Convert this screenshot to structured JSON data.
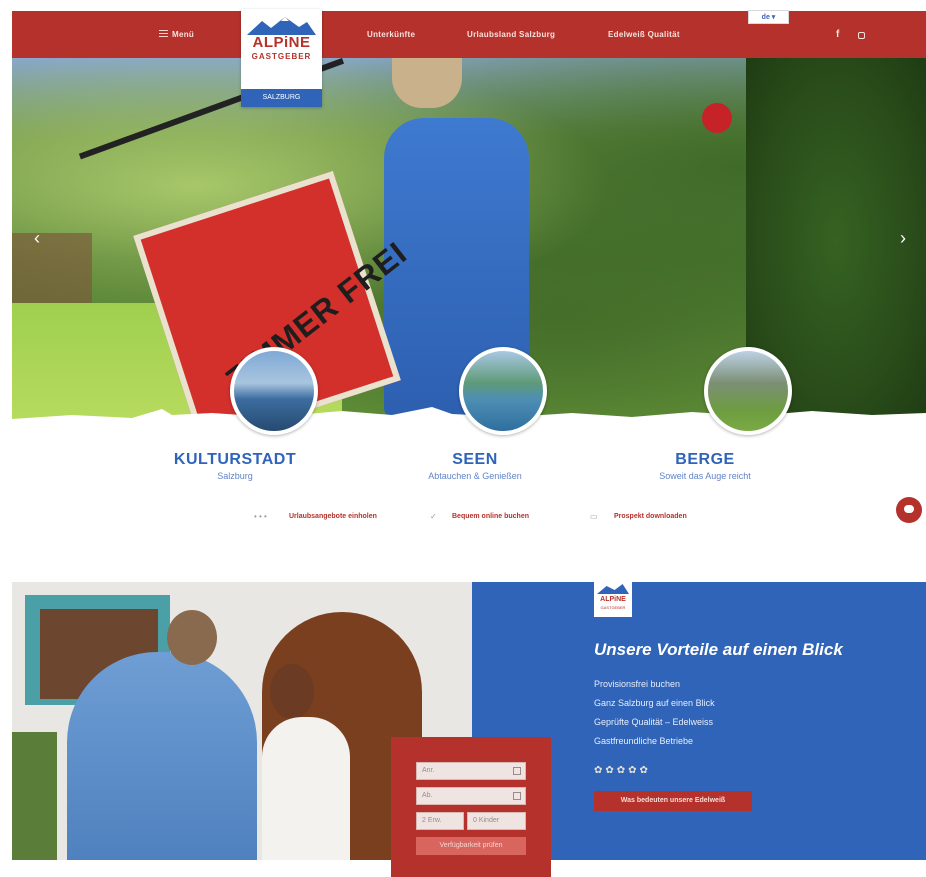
{
  "header": {
    "menu_label": "Menü",
    "nav": [
      "Unterkünfte",
      "Urlaubsland Salzburg",
      "Edelweiß Qualität"
    ],
    "language": "de ▾",
    "logo": {
      "line1": "ALPiNE",
      "line2": "GASTGEBER",
      "line3": "SALZBURG"
    },
    "social": {
      "facebook_icon": "f"
    }
  },
  "hero": {
    "prev_icon": "‹",
    "next_icon": "›",
    "flag_text": "ZIMMER FREI"
  },
  "categories": [
    {
      "title": "KULTURSTADT",
      "subtitle": "Salzburg"
    },
    {
      "title": "SEEN",
      "subtitle": "Abtauchen & Genießen"
    },
    {
      "title": "BERGE",
      "subtitle": "Soweit das Auge reicht"
    }
  ],
  "actions": [
    {
      "icon": "• • •",
      "label": "Urlaubsangebote einholen"
    },
    {
      "icon": "✓",
      "label": "Bequem online buchen"
    },
    {
      "icon": "▭",
      "label": "Prospekt downloaden"
    }
  ],
  "advantages": {
    "logo_line1": "ALPiNE",
    "logo_line2": "GASTGEBER",
    "heading": "Unsere Vorteile auf einen Blick",
    "items": [
      "Provisionsfrei buchen",
      "Ganz Salzburg auf einen Blick",
      "Geprüfte Qualität – Edelweiss",
      "Gastfreundliche Betriebe"
    ],
    "stars": "✿✿✿✿✿",
    "button_label": "Was bedeuten unsere Edelweiß"
  },
  "search": {
    "arrival_placeholder": "Anr.",
    "departure_placeholder": "Ab.",
    "adults_select": "2 Erw.",
    "children_select": "0 Kinder",
    "submit_label": "Verfügbarkeit prüfen"
  },
  "colors": {
    "brand_red": "#b4322b",
    "brand_blue": "#2f64b9",
    "white": "#ffffff"
  }
}
